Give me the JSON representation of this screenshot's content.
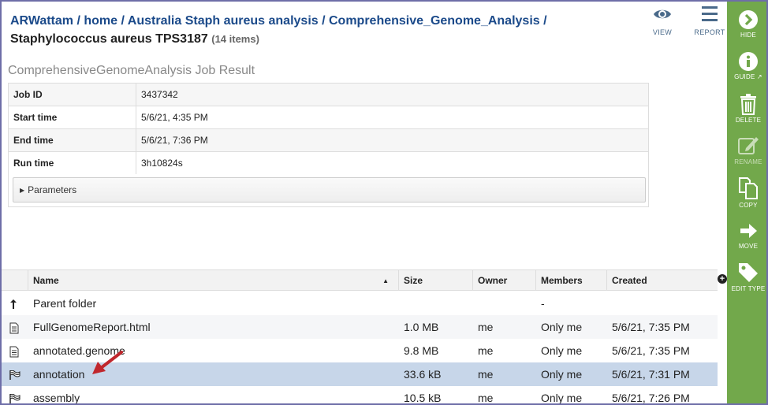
{
  "breadcrumb": {
    "user": "ARWattam",
    "sep": " / ",
    "home": "home",
    "folder1": "Australia Staph aureus analysis",
    "folder2": "Comprehensive_Genome_Analysis",
    "current": "Staphylococcus aureus TPS3187",
    "count": "(14 items)"
  },
  "top_actions": [
    {
      "label": "VIEW",
      "icon": "eye-icon"
    },
    {
      "label": "REPORT",
      "icon": "menu-icon"
    }
  ],
  "result": {
    "title": "ComprehensiveGenomeAnalysis Job Result",
    "fields": [
      {
        "key": "Job ID",
        "value": "3437342"
      },
      {
        "key": "Start time",
        "value": "5/6/21, 4:35 PM"
      },
      {
        "key": "End time",
        "value": "5/6/21, 7:36 PM"
      },
      {
        "key": "Run time",
        "value": "3h10824s"
      }
    ],
    "parameters_label": "Parameters"
  },
  "grid": {
    "columns": {
      "name": "Name",
      "size": "Size",
      "owner": "Owner",
      "members": "Members",
      "created": "Created"
    },
    "rows": [
      {
        "icon": "parent-folder-icon",
        "name": "Parent folder",
        "size": "",
        "owner": "",
        "members": "-",
        "created": ""
      },
      {
        "icon": "document-icon",
        "name": "FullGenomeReport.html",
        "size": "1.0 MB",
        "owner": "me",
        "members": "Only me",
        "created": "5/6/21, 7:35 PM"
      },
      {
        "icon": "document-icon",
        "name": "annotated.genome",
        "size": "9.8 MB",
        "owner": "me",
        "members": "Only me",
        "created": "5/6/21, 7:35 PM"
      },
      {
        "icon": "job-flag-icon",
        "name": "annotation",
        "size": "33.6 kB",
        "owner": "me",
        "members": "Only me",
        "created": "5/6/21, 7:31 PM",
        "selected": true
      },
      {
        "icon": "job-flag-icon",
        "name": "assembly",
        "size": "10.5 kB",
        "owner": "me",
        "members": "Only me",
        "created": "5/6/21, 7:26 PM"
      }
    ]
  },
  "sidebar": [
    {
      "label": "HIDE",
      "icon": "chevron-right-circle-icon"
    },
    {
      "label": "GUIDE",
      "icon": "info-icon"
    },
    {
      "label": "DELETE",
      "icon": "trash-icon"
    },
    {
      "label": "RENAME",
      "icon": "edit-icon",
      "disabled": true
    },
    {
      "label": "COPY",
      "icon": "copy-icon"
    },
    {
      "label": "MOVE",
      "icon": "arrow-right-icon"
    },
    {
      "label": "EDIT TYPE",
      "icon": "tag-icon"
    }
  ],
  "colors": {
    "sidebar": "#72a84b",
    "link": "#1b4a8a",
    "selected_row": "#c7d6e9",
    "arrow": "#c0272d"
  }
}
